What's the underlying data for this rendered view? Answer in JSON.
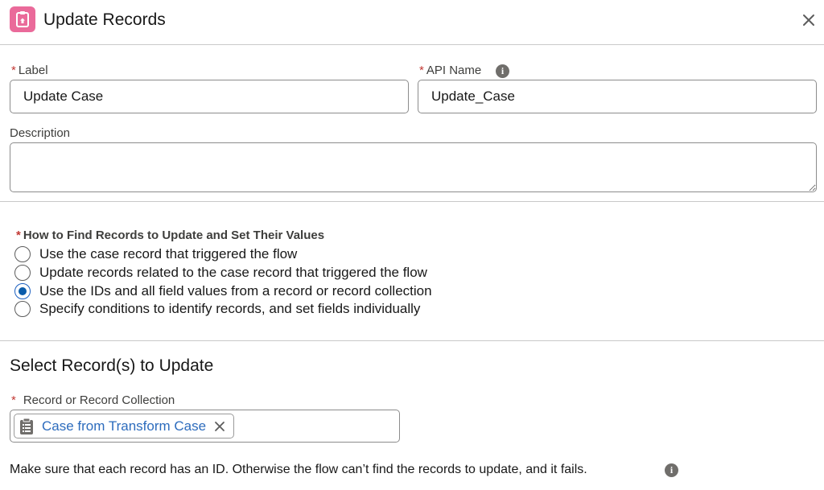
{
  "header": {
    "title": "Update Records",
    "icon": "clipboard-icon",
    "icon_color": "#ea6a9a"
  },
  "form": {
    "required_marker": "*",
    "label_field": {
      "label": "Label",
      "value": "Update Case"
    },
    "api_name_field": {
      "label": "API Name",
      "value": "Update_Case"
    },
    "description_field": {
      "label": "Description",
      "value": ""
    }
  },
  "find_records": {
    "label": "How to Find Records to Update and Set Their Values",
    "options": [
      {
        "label": "Use the case record that triggered the flow",
        "checked": false
      },
      {
        "label": "Update records related to the case record that triggered the flow",
        "checked": false
      },
      {
        "label": "Use the IDs and all field values from a record or record collection",
        "checked": true
      },
      {
        "label": "Specify conditions to identify records, and set fields individually",
        "checked": false
      }
    ]
  },
  "select_records": {
    "title": "Select Record(s) to Update",
    "field_label": "Record or Record Collection",
    "pill_label": "Case from Transform Case",
    "pill_icon": "record-collection-icon",
    "help_text": "Make sure that each record has an ID. Otherwise the flow can’t find the records to update, and it fails."
  },
  "colors": {
    "accent": "#0b5cab",
    "link": "#2d6cbd",
    "required": "#c23934"
  }
}
